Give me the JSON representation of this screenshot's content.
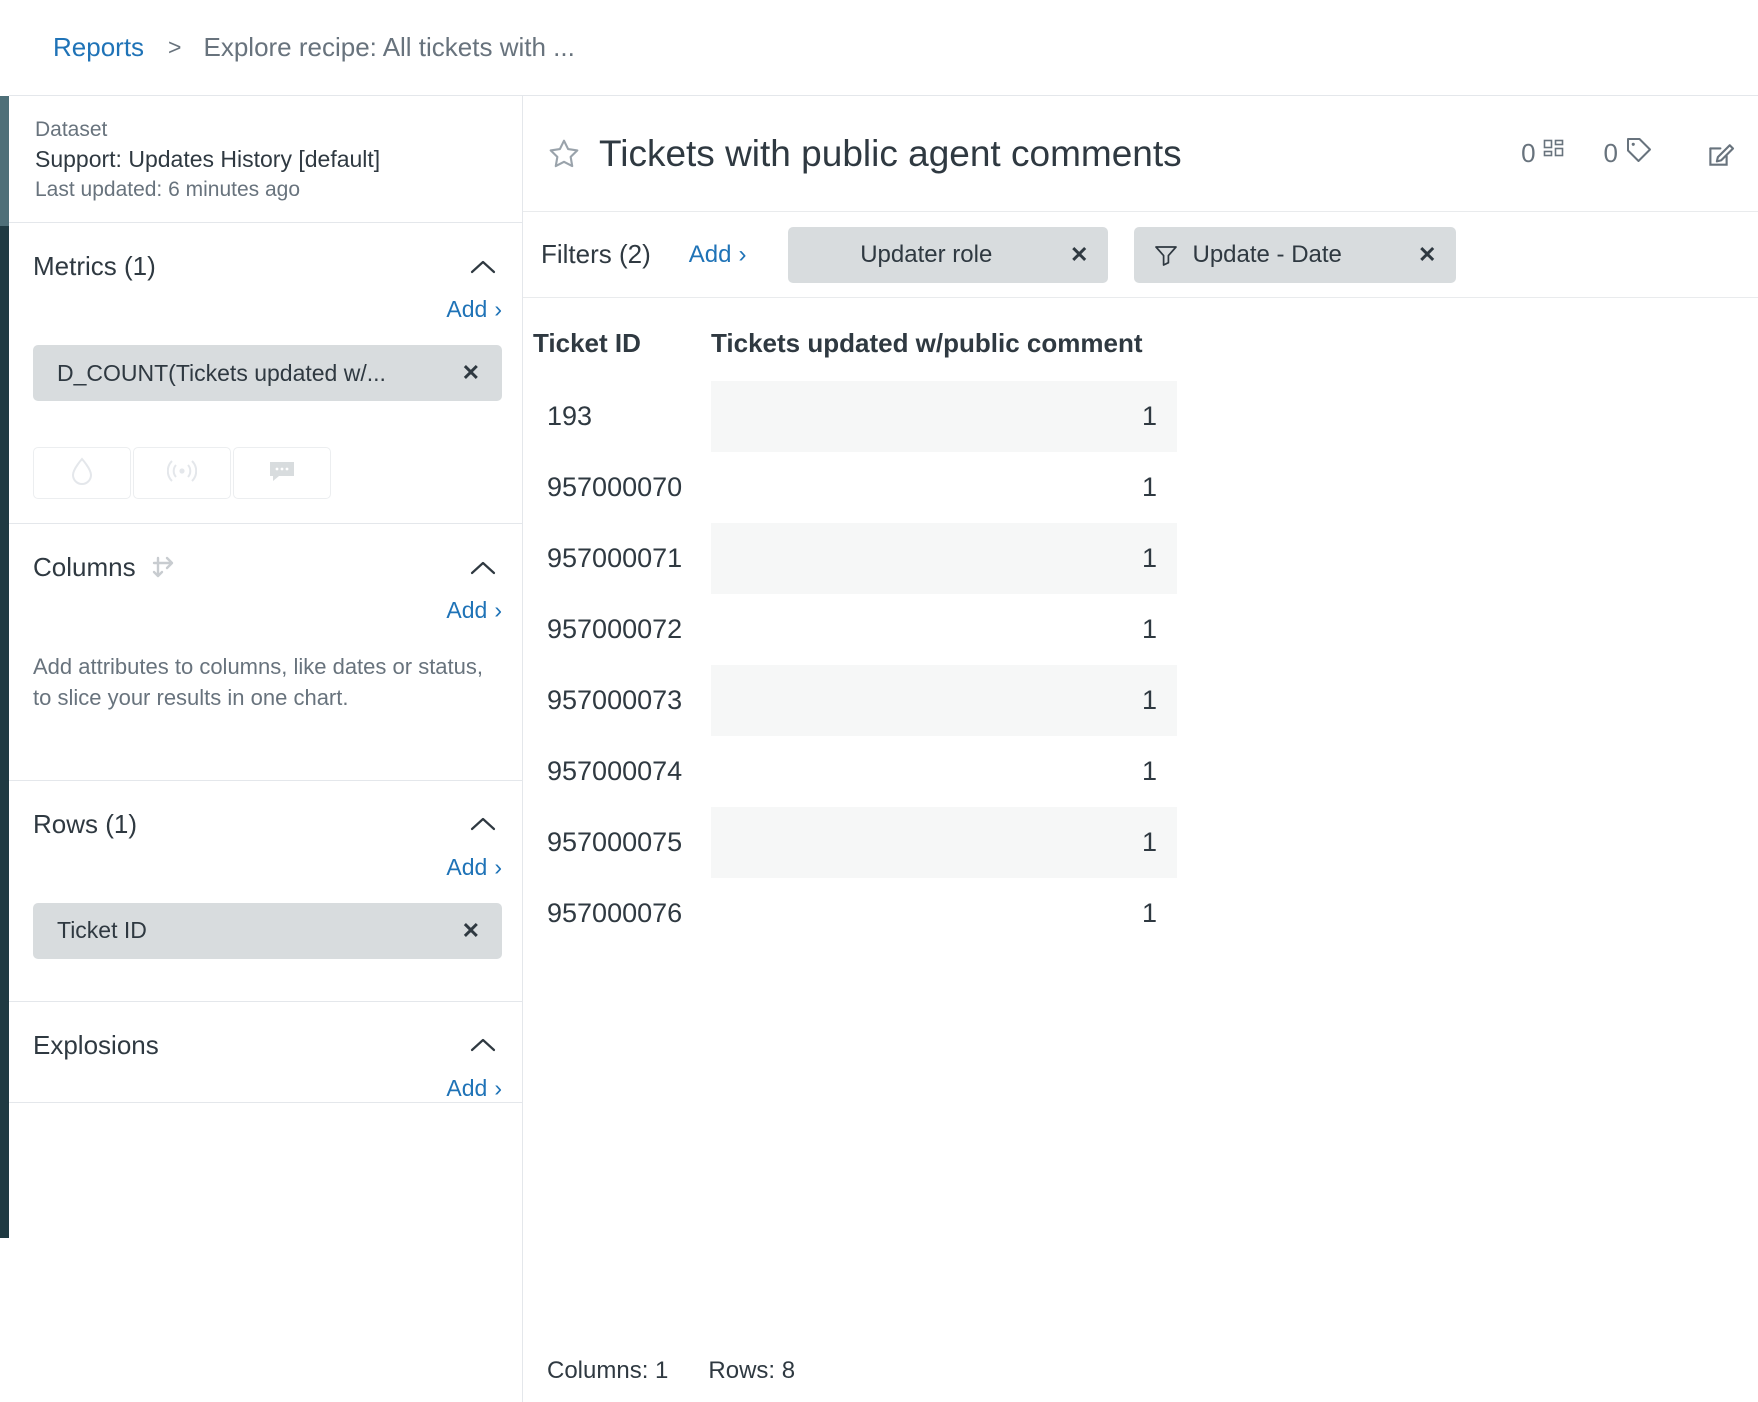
{
  "breadcrumb": {
    "root": "Reports",
    "separator": ">",
    "current": "Explore recipe: All tickets with ..."
  },
  "sidebar": {
    "dataset": {
      "label": "Dataset",
      "name": "Support: Updates History [default]",
      "updated": "Last updated: 6 minutes ago"
    },
    "metrics": {
      "title": "Metrics (1)",
      "add_label": "Add",
      "add_caret": "›",
      "chips": [
        {
          "label": "D_COUNT(Tickets updated w/...",
          "remove": "✕"
        }
      ],
      "mini_buttons": [
        {
          "icon": "droplet-icon"
        },
        {
          "icon": "broadcast-icon"
        },
        {
          "icon": "comment-icon"
        }
      ]
    },
    "columns": {
      "title": "Columns",
      "add_label": "Add",
      "add_caret": "›",
      "hint": "Add attributes to columns, like dates or status, to slice your results in one chart."
    },
    "rows": {
      "title": "Rows (1)",
      "add_label": "Add",
      "add_caret": "›",
      "chips": [
        {
          "label": "Ticket ID",
          "remove": "✕"
        }
      ]
    },
    "explosions": {
      "title": "Explosions",
      "add_label": "Add",
      "add_caret": "›"
    }
  },
  "main": {
    "title": "Tickets with public agent comments",
    "dashboard_count": "0",
    "tag_count": "0",
    "filters": {
      "label": "Filters (2)",
      "add_label": "Add",
      "add_caret": "›",
      "chips": [
        {
          "label": "Updater role",
          "remove": "✕",
          "has_funnel": false
        },
        {
          "label": "Update - Date",
          "remove": "✕",
          "has_funnel": true
        }
      ]
    },
    "footer": {
      "columns": "Columns: 1",
      "rows": "Rows: 8"
    }
  },
  "chart_data": {
    "type": "table",
    "title": "Tickets with public agent comments",
    "columns": [
      "Ticket ID",
      "Tickets updated w/public comment"
    ],
    "rows": [
      [
        "193",
        "1"
      ],
      [
        "957000070",
        "1"
      ],
      [
        "957000071",
        "1"
      ],
      [
        "957000072",
        "1"
      ],
      [
        "957000073",
        "1"
      ],
      [
        "957000074",
        "1"
      ],
      [
        "957000075",
        "1"
      ],
      [
        "957000076",
        "1"
      ]
    ]
  },
  "colors": {
    "link": "#1f73b7",
    "chip_bg": "#d8dcde",
    "text": "#2f3941",
    "muted": "#68737d",
    "rail": "#1f3a42",
    "accent_green": "#2b9c57"
  }
}
